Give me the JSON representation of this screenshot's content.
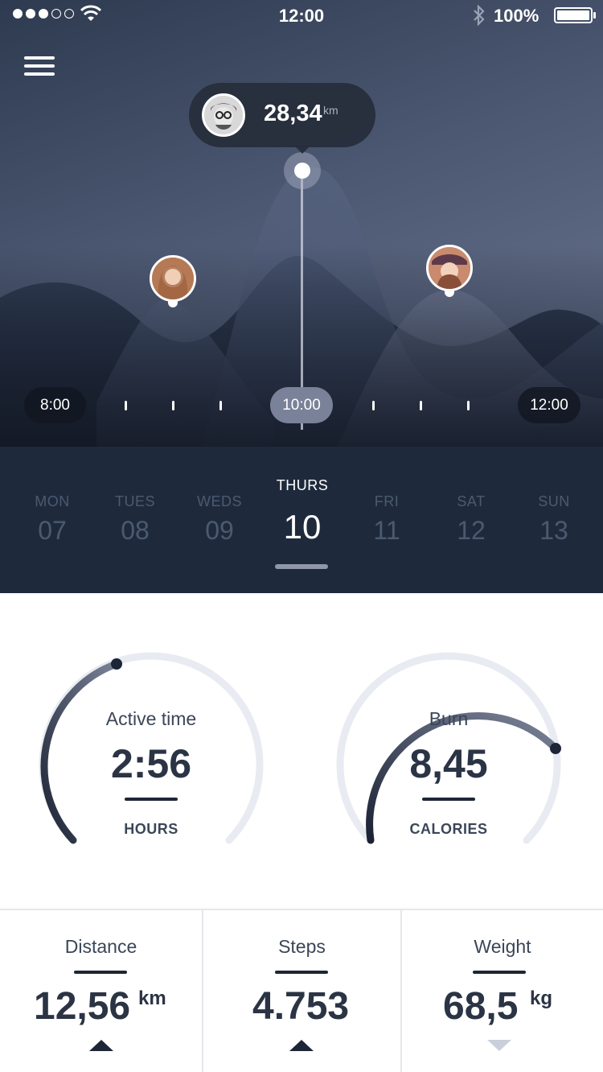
{
  "status_bar": {
    "signal_dots_filled": 3,
    "signal_dots_total": 5,
    "time": "12:00",
    "battery": "100%"
  },
  "header": {
    "menu_icon": "hamburger-menu-icon"
  },
  "graph": {
    "highlight": {
      "value": "28,34",
      "unit": "km"
    },
    "time_axis": {
      "start": "8:00",
      "selected": "10:00",
      "end": "12:00"
    }
  },
  "days": [
    {
      "name": "MON",
      "num": "07",
      "active": false
    },
    {
      "name": "TUES",
      "num": "08",
      "active": false
    },
    {
      "name": "WEDS",
      "num": "09",
      "active": false
    },
    {
      "name": "THURS",
      "num": "10",
      "active": true
    },
    {
      "name": "FRI",
      "num": "11",
      "active": false
    },
    {
      "name": "SAT",
      "num": "12",
      "active": false
    },
    {
      "name": "SUN",
      "num": "13",
      "active": false
    }
  ],
  "gauges": {
    "active_time": {
      "title": "Active time",
      "value": "2:56",
      "unit": "HOURS"
    },
    "burn": {
      "title": "Burn",
      "value": "8,45",
      "unit": "CALORIES"
    }
  },
  "stats": {
    "distance": {
      "label": "Distance",
      "value": "12,56",
      "unit": "km",
      "trend": "up"
    },
    "steps": {
      "label": "Steps",
      "value": "4.753",
      "trend": "up"
    },
    "weight": {
      "label": "Weight",
      "value": "68,5",
      "unit": "kg",
      "trend": "down"
    }
  },
  "colors": {
    "hero_top": "#2e3a4f",
    "days_bg": "#1e2a3c",
    "text_dark": "#2b3444",
    "gauge_track": "#e8ebf1"
  }
}
